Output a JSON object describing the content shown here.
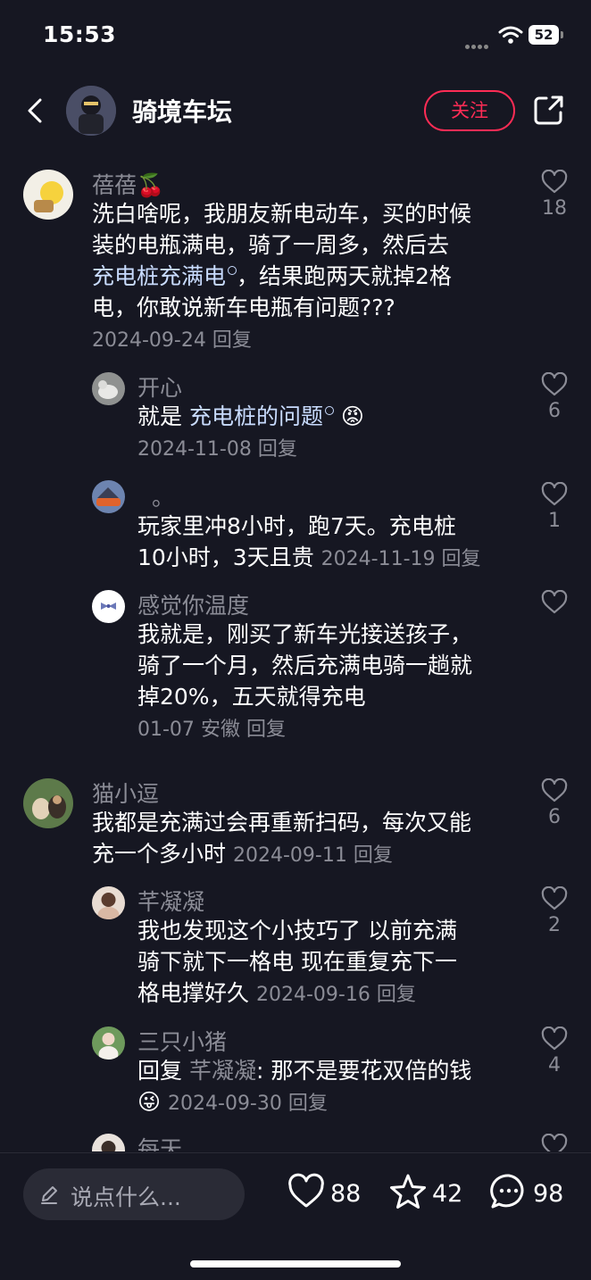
{
  "status_bar": {
    "time": "15:53",
    "battery": "52"
  },
  "header": {
    "channel_name": "骑境车坛",
    "follow_label": "关注"
  },
  "comments": [
    {
      "author": "蓓蓓🍒",
      "text_lines": [
        "洗白啥呢，我朋友新电动车，买的时候",
        "装的电瓶满电，骑了一周多，然后去"
      ],
      "link": "充电桩充满电",
      "line3_rest": "，结果跑两天就掉2格",
      "line4": "电，你敢说新车电瓶有问题???",
      "date": "2024-09-24",
      "reply_label": "回复",
      "likes": "18",
      "replies": [
        {
          "author": "开心",
          "prefix": "就是 ",
          "link": "充电桩的问题",
          "emoji": "😡",
          "date": "2024-11-08",
          "reply_label": "回复",
          "likes": "6"
        },
        {
          "author": "。",
          "text_lines": [
            "玩家里冲8小时，跑7天。充电桩",
            "10小时，3天且贵"
          ],
          "date": "2024-11-19",
          "reply_label": "回复",
          "likes": "1"
        },
        {
          "author": "感觉你温度",
          "text_lines": [
            "我就是，刚买了新车光接送孩子，",
            "骑了一个月，然后充满电骑一趟就",
            "掉20%，五天就得充电"
          ],
          "date": "01-07",
          "location": "安徽",
          "reply_label": "回复",
          "likes": ""
        }
      ]
    },
    {
      "author": "猫小逗",
      "text_lines": [
        "我都是充满过会再重新扫码，每次又能",
        "充一个多小时"
      ],
      "date": "2024-09-11",
      "reply_label": "回复",
      "likes": "6",
      "replies": [
        {
          "author": "芊凝凝",
          "text_lines": [
            "我也发现这个小技巧了  以前充满",
            "骑下就下一格电   现在重复充下一",
            "格电撑好久"
          ],
          "date": "2024-09-16",
          "reply_label": "回复",
          "likes": "2"
        },
        {
          "author": "三只小猪",
          "reply_word": "回复 ",
          "reply_to": "芊凝凝",
          "text": ": 那不是要花双倍的钱",
          "emoji": "😜",
          "date": "2024-09-30",
          "reply_label": "回复",
          "likes": "4"
        },
        {
          "author": "每天"
        }
      ]
    }
  ],
  "bottom_bar": {
    "input_placeholder": "说点什么...",
    "like_count": "88",
    "favorite_count": "42",
    "comment_count": "98"
  },
  "colors": {
    "background": "#161722",
    "accent": "#fe2c55",
    "link": "#c9dcff",
    "muted": "#8b8c96"
  }
}
